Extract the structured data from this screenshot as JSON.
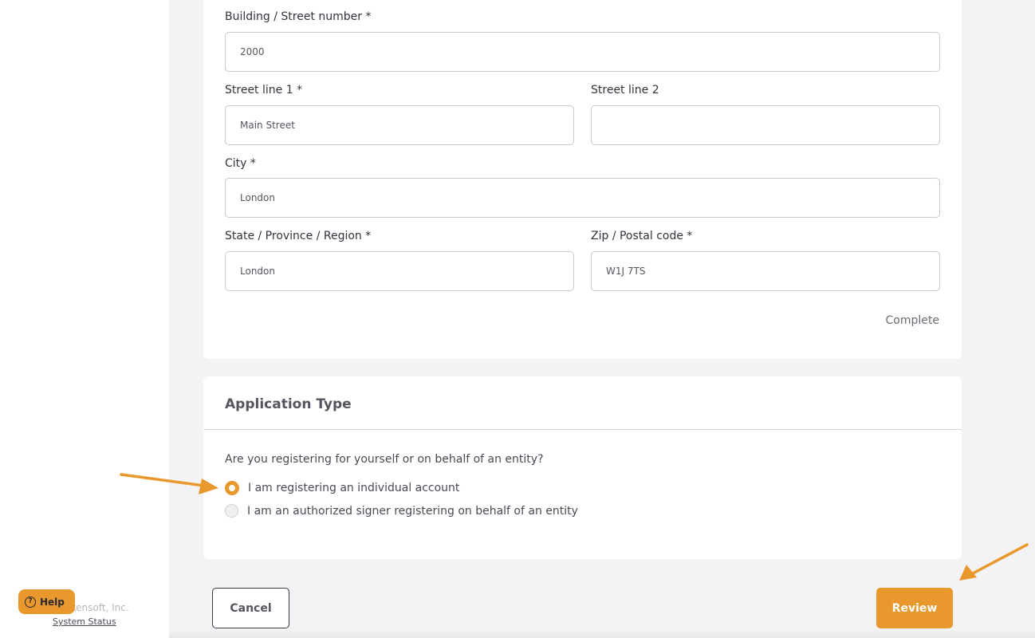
{
  "address": {
    "building": {
      "label": "Building / Street number *",
      "value": "2000"
    },
    "street1": {
      "label": "Street line 1 *",
      "value": "Main Street"
    },
    "street2": {
      "label": "Street line 2",
      "value": ""
    },
    "city": {
      "label": "City *",
      "value": "London"
    },
    "state": {
      "label": "State / Province / Region *",
      "value": "London"
    },
    "zip": {
      "label": "Zip / Postal code *",
      "value": "W1J 7TS"
    },
    "status": "Complete"
  },
  "application_type": {
    "title": "Application Type",
    "question": "Are you registering for yourself or on behalf of an entity?",
    "options": [
      {
        "label": "I am registering an individual account",
        "selected": true
      },
      {
        "label": "I am an authorized signer registering on behalf of an entity",
        "selected": false
      }
    ]
  },
  "actions": {
    "cancel": "Cancel",
    "review": "Review"
  },
  "footer": {
    "company": "Tokensoft, Inc.",
    "system_status": "System Status",
    "help": "Help"
  },
  "colors": {
    "accent": "#e8982d"
  },
  "icons": {
    "help": "question-circle-icon",
    "annotation": "arrow-icon"
  }
}
